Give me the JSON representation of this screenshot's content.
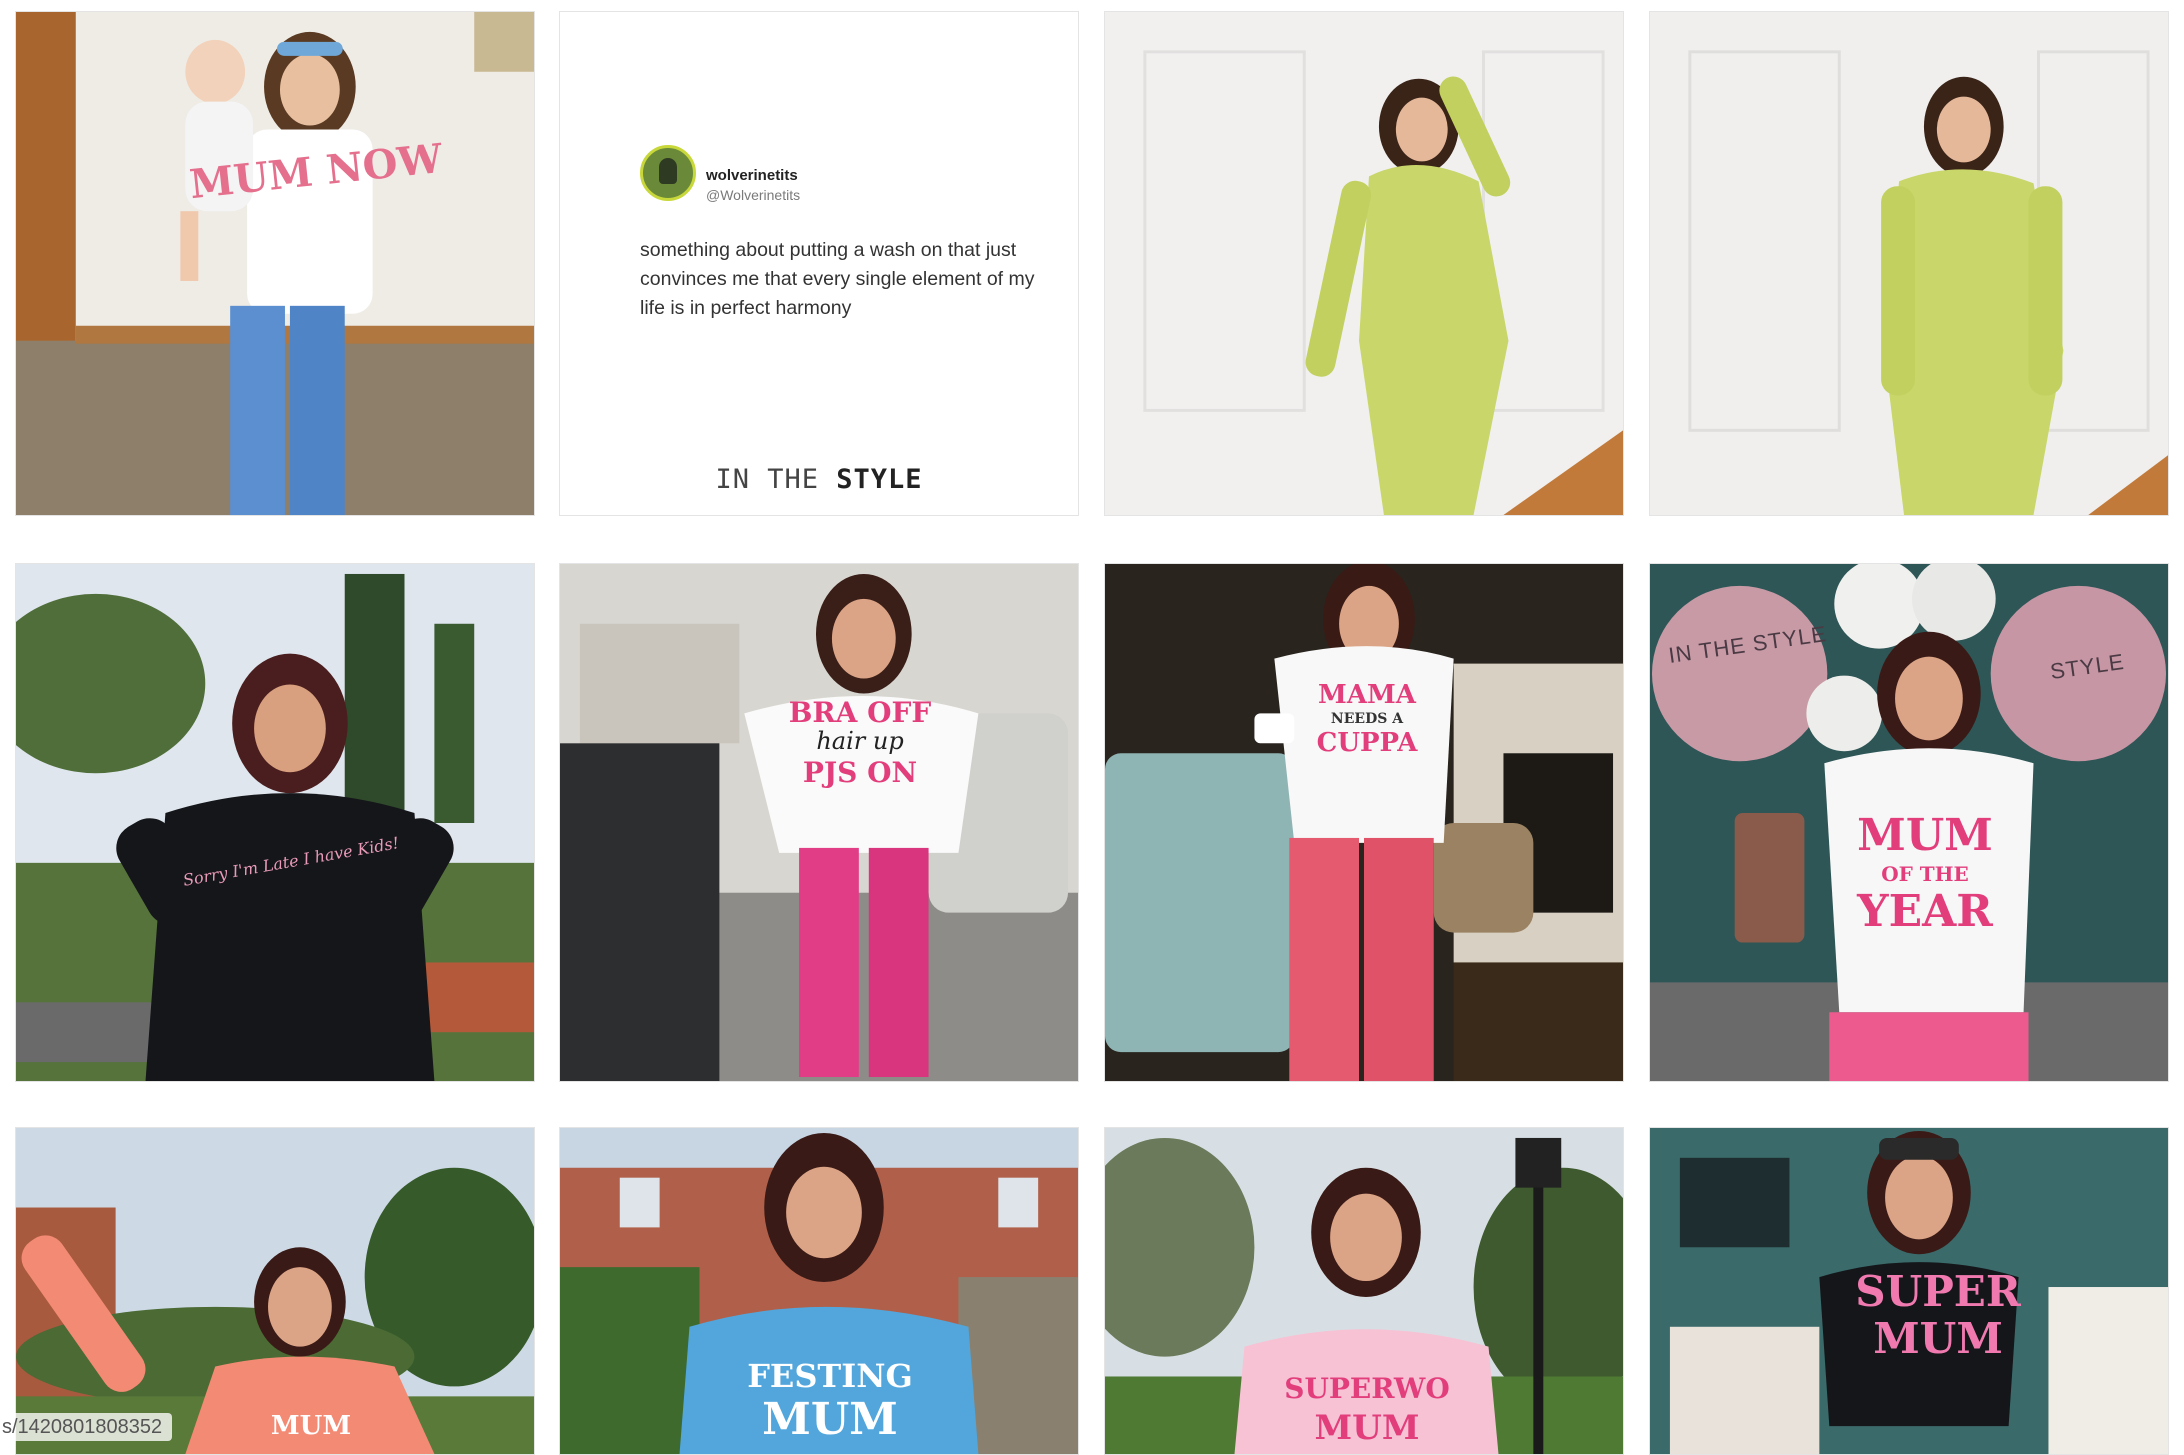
{
  "grid": {
    "tiles": [
      {
        "id": "mum-baby-pajamas",
        "shirt": "MUM NOW"
      },
      {
        "id": "tweet-card"
      },
      {
        "id": "green-knit-dress-pose-1"
      },
      {
        "id": "green-knit-dress-pose-2"
      },
      {
        "id": "black-hoodie-garden",
        "shirt": "Sorry I'm Late I have Kids!"
      },
      {
        "id": "bra-off-tee",
        "shirt_lines": [
          "BRA OFF",
          "hair up",
          "PJS ON"
        ]
      },
      {
        "id": "mama-needs-cuppa",
        "shirt_lines": [
          "MAMA",
          "NEEDS A",
          "CUPPA"
        ]
      },
      {
        "id": "mum-of-the-year",
        "shirt_lines": [
          "MUM",
          "OF THE",
          "YEAR"
        ],
        "balloon_text": [
          "IN THE STYLE",
          "STYLE"
        ]
      },
      {
        "id": "coral-hoodie-waving",
        "shirt": "MUM"
      },
      {
        "id": "blue-hoodie-mum",
        "shirt_lines": [
          "FESTING",
          "MUM"
        ]
      },
      {
        "id": "pink-hoodie-superwoman",
        "shirt_lines": [
          "SUPERWO",
          "MUM"
        ]
      },
      {
        "id": "super-mum-tee",
        "shirt_lines": [
          "SUPER",
          "MUM"
        ]
      }
    ]
  },
  "tweet": {
    "name": "wolverinetits",
    "handle": "@Wolverinetits",
    "text": "something about putting a wash on that just convinces me that every single element of my life is in perfect harmony",
    "brand_prefix": "IN THE ",
    "brand_bold": "STYLE"
  },
  "overlay": {
    "url_fragment": "s/1420801808352"
  },
  "colors": {
    "pink_print": "#e6407a",
    "green_knit": "#c8d66a",
    "teal_wall": "#2f5a5a"
  }
}
